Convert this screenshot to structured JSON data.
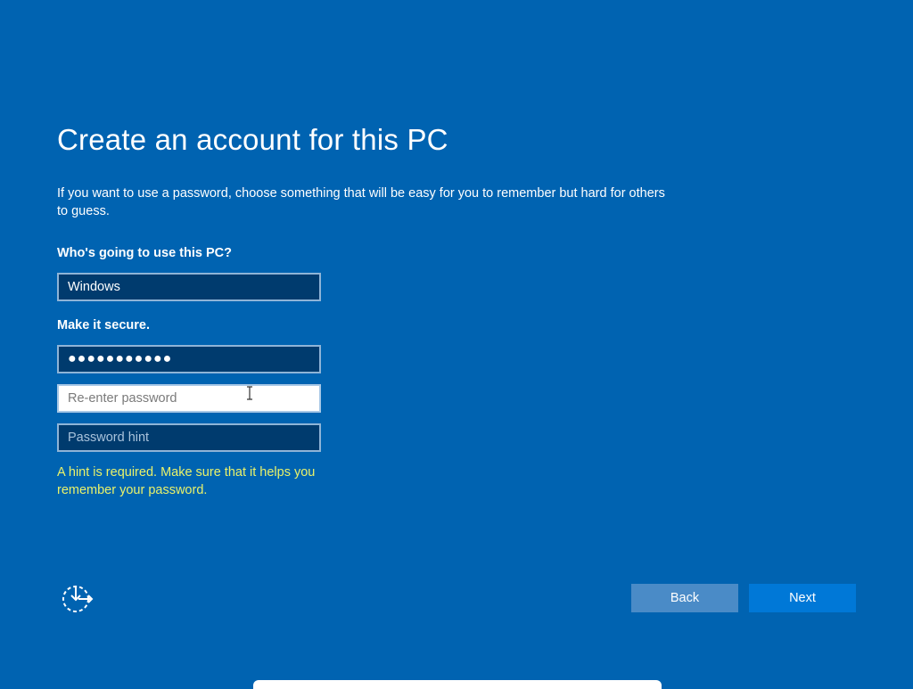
{
  "page": {
    "title": "Create an account for this PC",
    "description": "If you want to use a password, choose something that will be easy for you to remember but hard for others to guess."
  },
  "form": {
    "user_label": "Who's going to use this PC?",
    "username_value": "Windows",
    "secure_label": "Make it secure.",
    "password_value": "●●●●●●●●●●●",
    "reenter_placeholder": "Re-enter password",
    "hint_placeholder": "Password hint",
    "error_message": "A hint is required. Make sure that it helps you remember your password."
  },
  "buttons": {
    "back_label": "Back",
    "next_label": "Next"
  },
  "icons": {
    "ease_of_access": "ease-of-access-icon",
    "text_cursor": "text-cursor-icon"
  },
  "colors": {
    "background": "#0063b1",
    "input_background": "#003b6e",
    "error_text": "#e9f26a",
    "next_button": "#0078d7",
    "back_button": "#4a8bc7"
  }
}
